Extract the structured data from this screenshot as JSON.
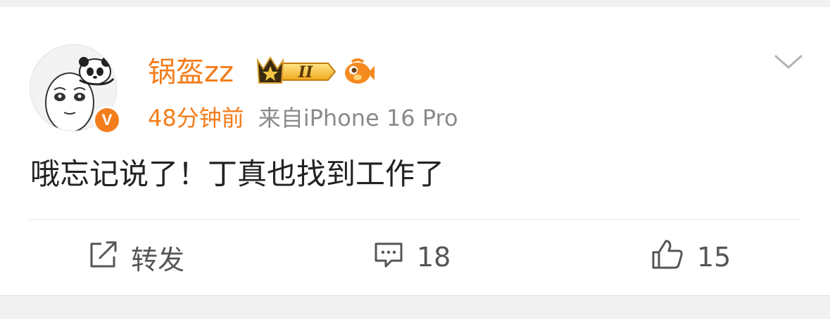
{
  "post": {
    "username": "锅盔zz",
    "time": "48分钟前",
    "source": "来自iPhone 16 Pro",
    "content": "哦忘记说了！丁真也找到工作了",
    "verified_mark": "V",
    "level_badge": "II",
    "icons": {
      "avatar": "panda-avatar-icon",
      "verified": "verified-badge-icon",
      "crown": "crown-level-badge-icon",
      "fish": "fish-badge-icon",
      "more": "chevron-down-icon",
      "repost": "repost-icon",
      "comment": "comment-icon",
      "like": "thumbs-up-icon"
    },
    "colors": {
      "accent": "#f37d1b",
      "text": "#222222",
      "meta": "#8a8a8a",
      "action": "#555555",
      "background": "#f1f1f1"
    }
  },
  "actions": {
    "repost_label": "转发",
    "comment_count": "18",
    "like_count": "15"
  }
}
